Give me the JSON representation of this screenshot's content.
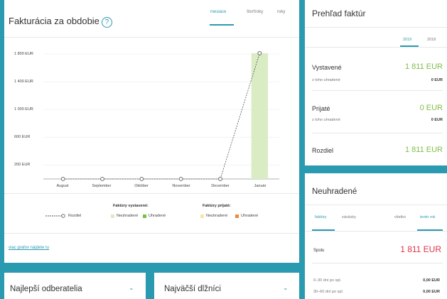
{
  "billing": {
    "title": "Fakturácia za obdobie",
    "tabs": [
      "mesiace",
      "štvrťroky",
      "roky"
    ],
    "active_tab": 0,
    "more_link": "viac grafov nájdete tu",
    "legend": {
      "line_label": "Rozdiel",
      "issued_title": "Faktúry vystavené:",
      "received_title": "Faktúry prijaté:",
      "unpaid": "Neuhradené",
      "paid": "Uhradené"
    }
  },
  "chart_data": {
    "type": "bar",
    "categories": [
      "August",
      "September",
      "Október",
      "November",
      "December",
      "Január"
    ],
    "y_ticks": [
      "1 800 EUR",
      "1 400 EUR",
      "1 000 EUR",
      "600 EUR",
      "200 EUR"
    ],
    "ylim": [
      0,
      1800
    ],
    "series": [
      {
        "name": "Neuhradené",
        "type": "bar",
        "group": "Faktúry vystavené",
        "values": [
          0,
          0,
          0,
          0,
          0,
          0
        ],
        "color": "#d9ecc4"
      },
      {
        "name": "Uhradené",
        "type": "bar",
        "group": "Faktúry vystavené",
        "values": [
          0,
          0,
          0,
          0,
          0,
          1811
        ],
        "color": "#7dbf45"
      },
      {
        "name": "Neuhradené",
        "type": "bar",
        "group": "Faktúry prijaté",
        "values": [
          0,
          0,
          0,
          0,
          0,
          0
        ],
        "color": "#f7e5a6"
      },
      {
        "name": "Uhradené",
        "type": "bar",
        "group": "Faktúry prijaté",
        "values": [
          0,
          0,
          0,
          0,
          0,
          0
        ],
        "color": "#ef8a3c"
      },
      {
        "name": "Rozdiel",
        "type": "line",
        "values": [
          0,
          0,
          0,
          0,
          0,
          1811
        ],
        "color": "#555555"
      }
    ]
  },
  "overview": {
    "title": "Prehľad faktúr",
    "year_tabs": [
      "2019",
      "2018"
    ],
    "issued_label": "Vystavené",
    "issued_value": "1 811 EUR",
    "issued_paid_label": "z toho uhradené",
    "issued_paid_value": "0 EUR",
    "received_label": "Prijaté",
    "received_value": "0 EUR",
    "received_paid_label": "z toho uhradené",
    "received_paid_value": "0 EUR",
    "diff_label": "Rozdiel",
    "diff_value": "1 811 EUR"
  },
  "unpaid": {
    "title": "Neuhradené",
    "tabs": [
      "faktúry",
      "záväzky",
      "všetko",
      "tento rok"
    ],
    "total_label": "Spolu",
    "total_value": "1 811 EUR",
    "rows": [
      {
        "label": "0–30 dní po spl.",
        "value": "0,00 EUR"
      },
      {
        "label": "30–60 dní po spl.",
        "value": "0,00 EUR"
      }
    ]
  },
  "best_customers": {
    "title": "Najlepší odberatelia"
  },
  "largest_debtors": {
    "title": "Najväčší dlžníci"
  },
  "colors": {
    "accent": "#2a9ab0",
    "green": "#7dbf45",
    "red": "#e0334b"
  }
}
